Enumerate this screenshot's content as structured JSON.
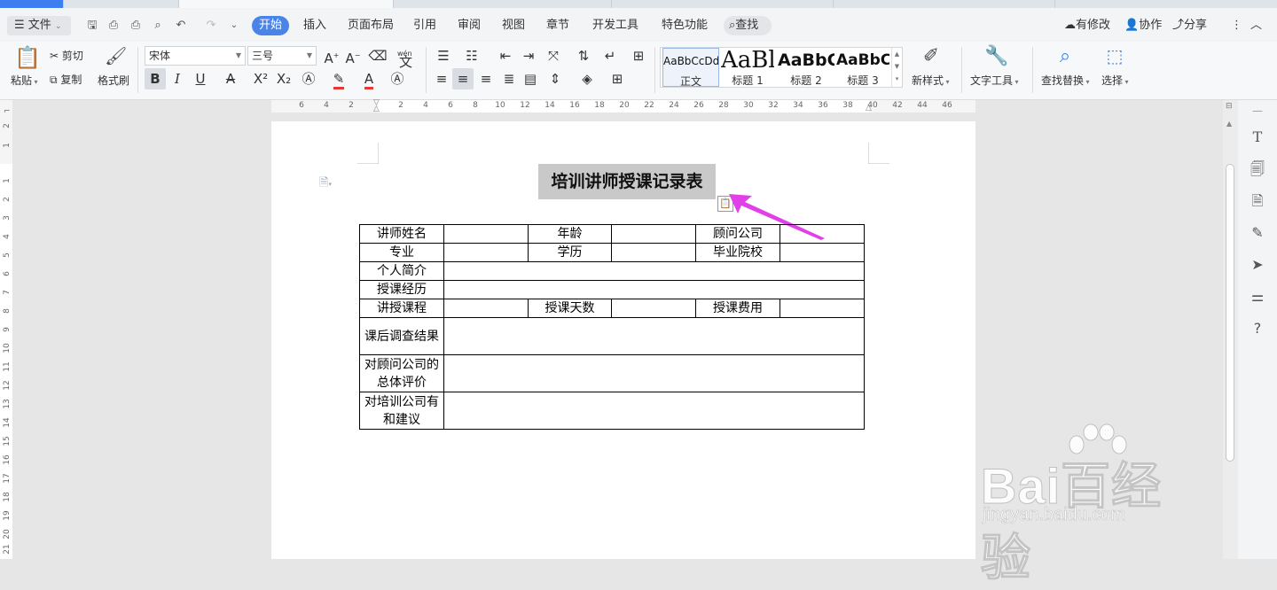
{
  "menubar": {
    "file_label": "文件",
    "tabs": [
      "开始",
      "插入",
      "页面布局",
      "引用",
      "审阅",
      "视图",
      "章节",
      "开发工具",
      "特色功能"
    ],
    "search_label": "查找",
    "right": {
      "modified": "有修改",
      "collaborate": "协作",
      "share": "分享"
    }
  },
  "ribbon": {
    "paste": "粘贴",
    "cut": "剪切",
    "copy": "复制",
    "format_painter": "格式刷",
    "font_name": "宋体",
    "font_size": "三号",
    "pinyin_glyph": "wén",
    "styles": [
      {
        "preview": "AaBbCcDd",
        "name": "正文"
      },
      {
        "preview": "AaBl",
        "name": "标题 1"
      },
      {
        "preview": "AaBbC",
        "name": "标题 2"
      },
      {
        "preview": "AaBbC",
        "name": "标题 3"
      }
    ],
    "new_style": "新样式",
    "text_tools": "文字工具",
    "find_replace": "查找替换",
    "select": "选择"
  },
  "ruler": {
    "h_left": [
      "6",
      "4",
      "2"
    ],
    "h_right": [
      "2",
      "4",
      "6",
      "8",
      "10",
      "12",
      "14",
      "16",
      "18",
      "20",
      "22",
      "24",
      "26",
      "28",
      "30",
      "32",
      "34",
      "36",
      "38",
      "40",
      "42",
      "44",
      "46"
    ],
    "v": [
      "2",
      "1",
      "1",
      "2",
      "3",
      "4",
      "5",
      "6",
      "7",
      "8",
      "9",
      "10",
      "11",
      "12",
      "13",
      "14",
      "15",
      "16",
      "17",
      "18",
      "19",
      "20",
      "21"
    ]
  },
  "document": {
    "title": "培训讲师授课记录表",
    "table": {
      "row1": [
        "讲师姓名",
        "",
        "年龄",
        "",
        "顾问公司",
        ""
      ],
      "row2": [
        "专业",
        "",
        "学历",
        "",
        "毕业院校",
        ""
      ],
      "row3": [
        "个人简介"
      ],
      "row4": [
        "授课经历"
      ],
      "row5": [
        "讲授课程",
        "",
        "授课天数",
        "",
        "授课费用",
        ""
      ],
      "row6": [
        "课后调查结果"
      ],
      "row7": [
        "对顾问公司的总体评价"
      ],
      "row8": [
        "对培训公司有和建议"
      ]
    }
  },
  "watermark": {
    "logo": "Bai百经验",
    "url": "jingyan.baidu.com"
  },
  "colors": {
    "accent": "#4a84e8",
    "arrow": "#e040e8",
    "selection": "#c9c9c9"
  }
}
